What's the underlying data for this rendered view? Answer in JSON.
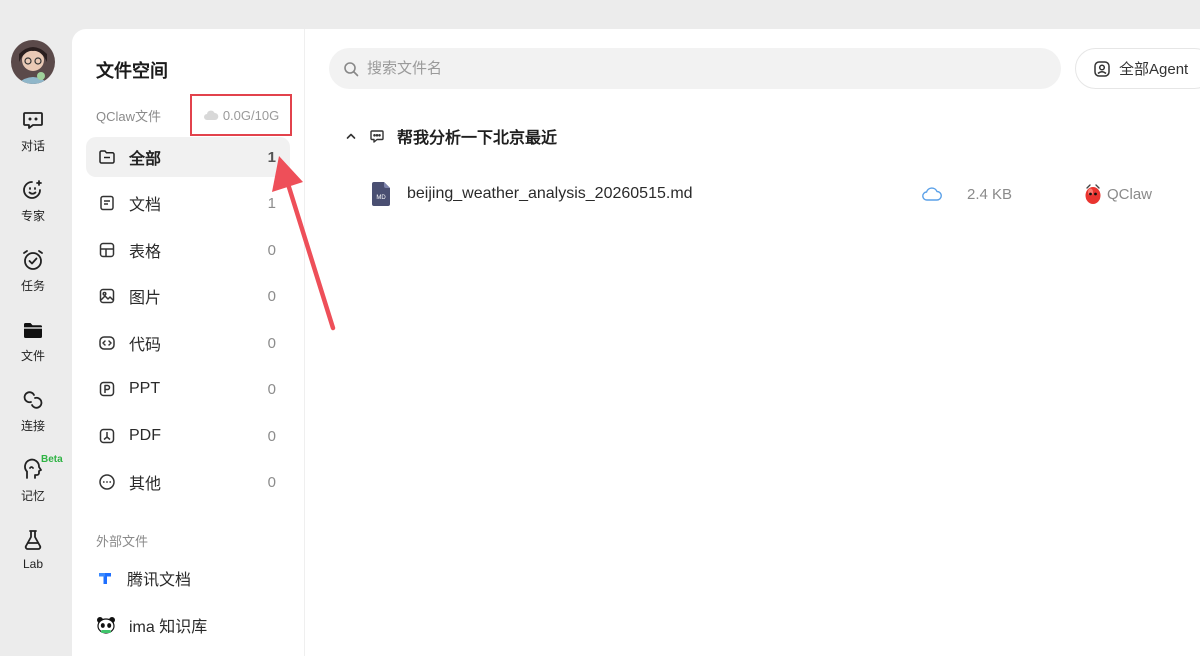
{
  "rail": {
    "items": [
      {
        "label": "对话",
        "icon": "chat-icon"
      },
      {
        "label": "专家",
        "icon": "smile-sparkle-icon"
      },
      {
        "label": "任务",
        "icon": "alarm-icon"
      },
      {
        "label": "文件",
        "icon": "folder-icon"
      },
      {
        "label": "连接",
        "icon": "link-icon"
      },
      {
        "label": "记忆",
        "icon": "brain-icon",
        "badge": "Beta"
      },
      {
        "label": "Lab",
        "icon": "flask-icon"
      }
    ]
  },
  "panel": {
    "title": "文件空间",
    "qclaw_label": "QClaw文件",
    "storage": "0.0G/10G",
    "categories": [
      {
        "label": "全部",
        "count": "1"
      },
      {
        "label": "文档",
        "count": "1"
      },
      {
        "label": "表格",
        "count": "0"
      },
      {
        "label": "图片",
        "count": "0"
      },
      {
        "label": "代码",
        "count": "0"
      },
      {
        "label": "PPT",
        "count": "0"
      },
      {
        "label": "PDF",
        "count": "0"
      },
      {
        "label": "其他",
        "count": "0"
      }
    ],
    "external_label": "外部文件",
    "external": [
      {
        "label": "腾讯文档"
      },
      {
        "label": "ima 知识库"
      }
    ]
  },
  "content": {
    "search_placeholder": "搜索文件名",
    "agent_filter": "全部Agent",
    "group_title": "帮我分析一下北京最近",
    "file": {
      "name": "beijing_weather_analysis_20260515.md",
      "type_badge": "MD",
      "size": "2.4 KB",
      "owner": "QClaw"
    }
  },
  "colors": {
    "accent_red": "#e2424c",
    "beta_green": "#2fb344",
    "md_icon": "#4a4f72"
  }
}
